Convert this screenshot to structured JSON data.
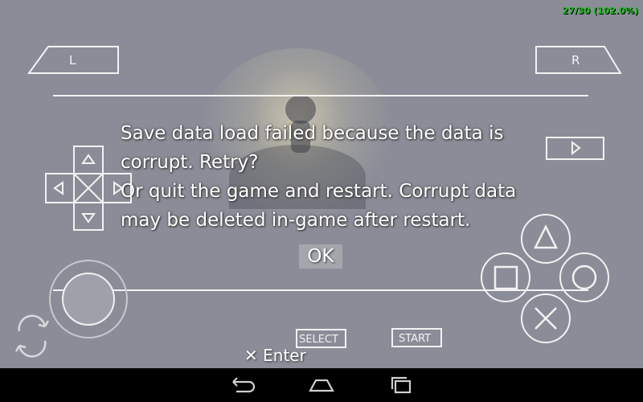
{
  "status": {
    "fps": "27/30 (102.0%)"
  },
  "controls": {
    "l_label": "L",
    "r_label": "R",
    "select_label": "SELECT",
    "start_label": "START"
  },
  "dialog": {
    "message": "Save data load failed because the data is\ncorrupt. Retry?\nOr quit the game and restart. Corrupt data\nmay be deleted in-game after restart.",
    "ok_label": "OK"
  },
  "hint": {
    "enter_label": "Enter"
  },
  "colors": {
    "fps": "#10c010",
    "overlay": "#f2f2f2",
    "background": "#8a8d98"
  }
}
